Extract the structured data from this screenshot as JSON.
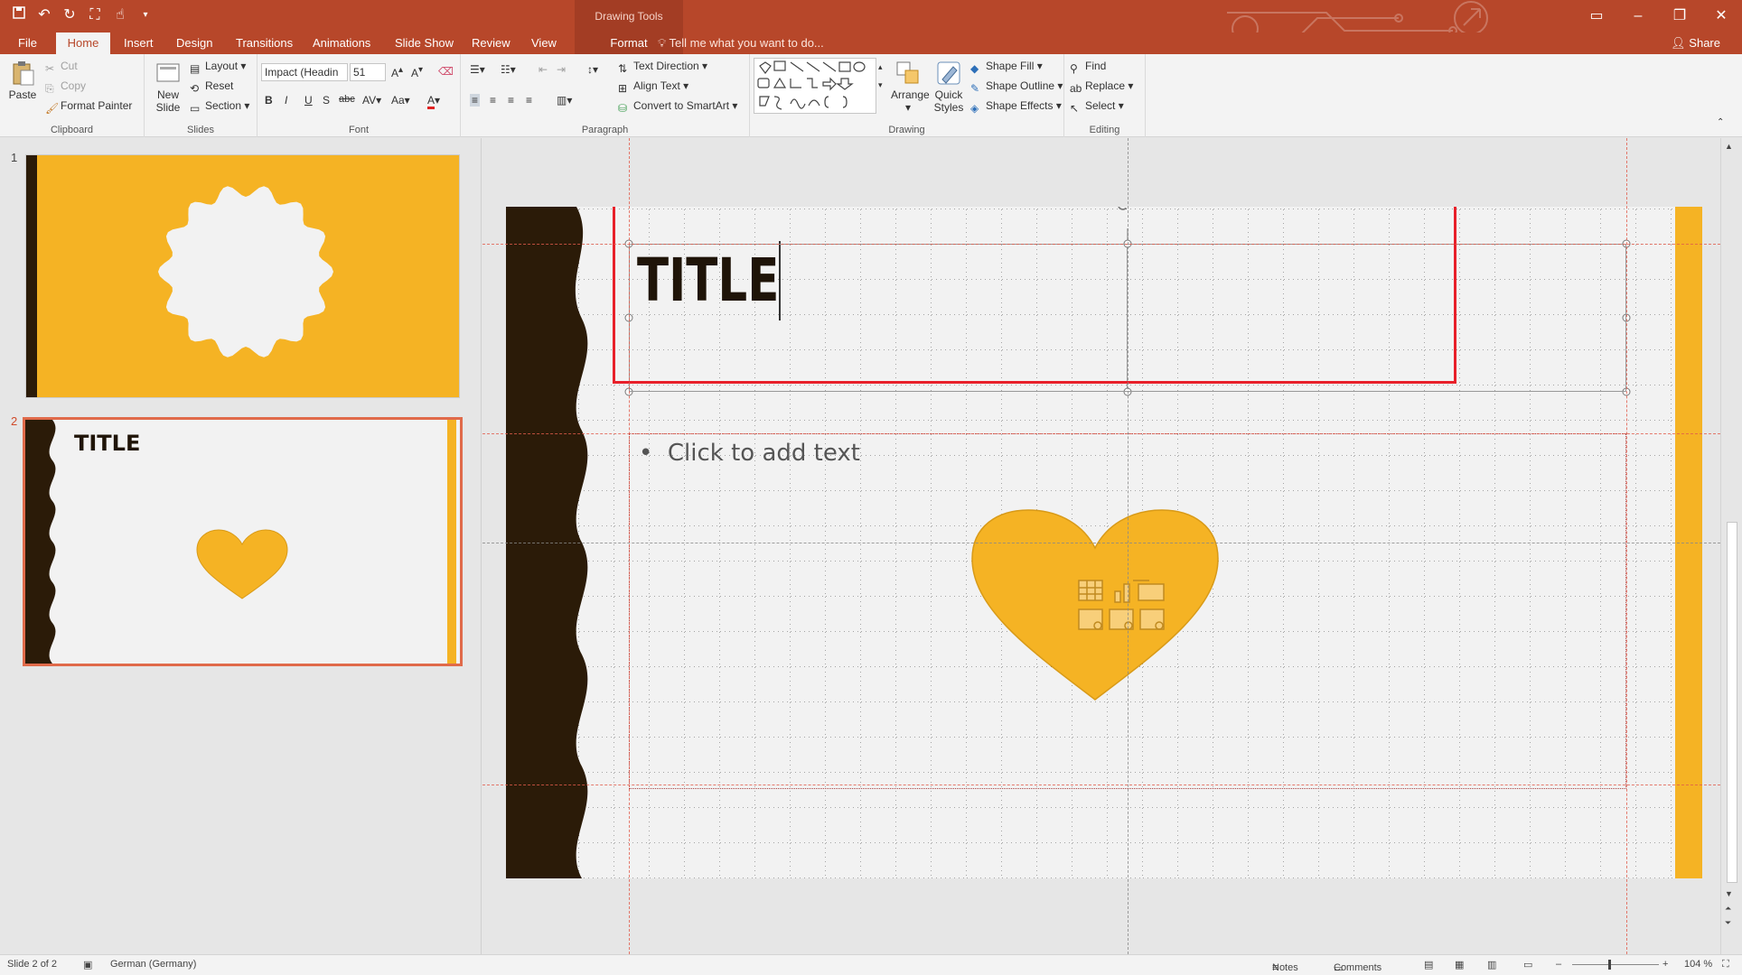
{
  "window": {
    "contextual_tab_group": "Drawing Tools",
    "accent_color": "#b7472a"
  },
  "tabs": [
    {
      "label": "File"
    },
    {
      "label": "Home"
    },
    {
      "label": "Insert"
    },
    {
      "label": "Design"
    },
    {
      "label": "Transitions"
    },
    {
      "label": "Animations"
    },
    {
      "label": "Slide Show"
    },
    {
      "label": "Review"
    },
    {
      "label": "View"
    },
    {
      "label": "Format"
    }
  ],
  "tell_me": "Tell me what you want to do...",
  "share": "Share",
  "ribbon": {
    "clipboard": {
      "paste": "Paste",
      "cut": "Cut",
      "copy": "Copy",
      "format_painter": "Format Painter",
      "label": "Clipboard"
    },
    "slides": {
      "new_slide_1": "New",
      "new_slide_2": "Slide",
      "layout": "Layout",
      "reset": "Reset",
      "section": "Section",
      "label": "Slides"
    },
    "font": {
      "font_name": "Impact (Headin",
      "font_size": "51",
      "label": "Font"
    },
    "paragraph": {
      "text_direction": "Text Direction",
      "align_text": "Align Text",
      "convert_smartart": "Convert to SmartArt",
      "label": "Paragraph"
    },
    "drawing": {
      "arrange": "Arrange",
      "quick_styles_1": "Quick",
      "quick_styles_2": "Styles",
      "shape_fill": "Shape Fill",
      "shape_outline": "Shape Outline",
      "shape_effects": "Shape Effects",
      "label": "Drawing"
    },
    "editing": {
      "find": "Find",
      "replace": "Replace",
      "select": "Select",
      "label": "Editing"
    }
  },
  "thumbnails": [
    {
      "number": "1"
    },
    {
      "number": "2",
      "title": "TITLE"
    }
  ],
  "slide": {
    "title": "TITLE",
    "body_placeholder": "Click to add text"
  },
  "status": {
    "slide_info": "Slide 2 of 2",
    "language": "German (Germany)",
    "notes": "Notes",
    "comments": "Comments",
    "zoom": "104 %"
  },
  "colors": {
    "slide_yellow": "#f5b324",
    "slide_dark": "#2b1b08",
    "slide_bg": "#f2f2f2",
    "highlight_red": "#e8202a"
  }
}
